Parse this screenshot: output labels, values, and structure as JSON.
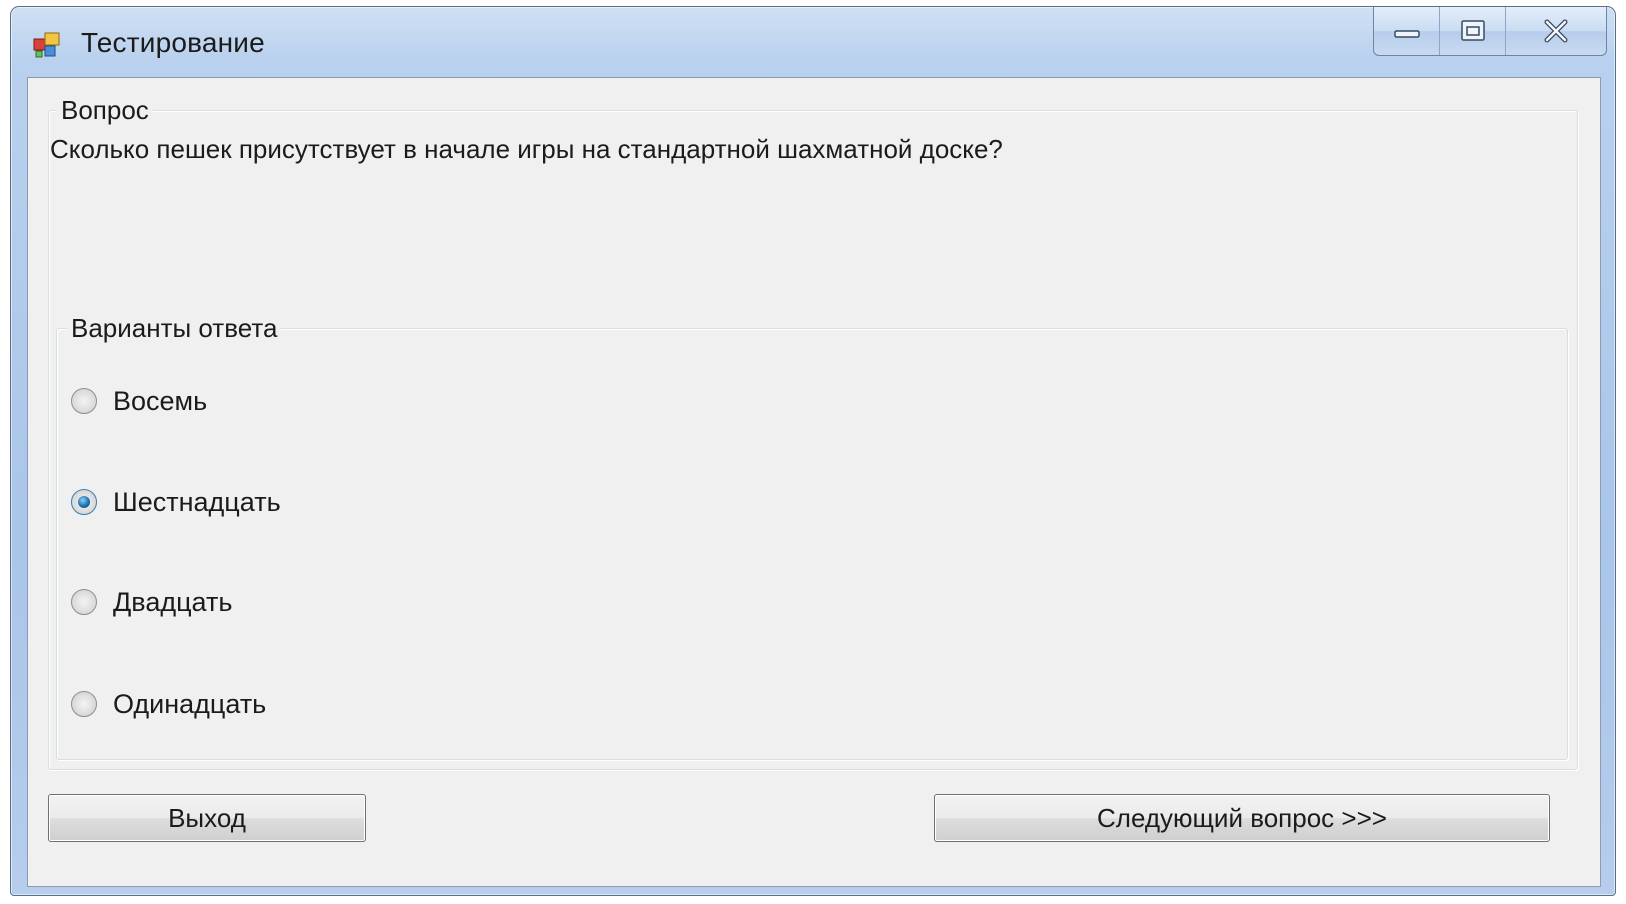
{
  "window": {
    "title": "Тестирование",
    "icon": "app-icon",
    "caption_buttons": [
      "minimize-icon",
      "maximize-icon",
      "close-icon"
    ]
  },
  "question": {
    "group_label": "Вопрос",
    "text": "Сколько пешек присутствует в начале игры на стандартной шахматной доске?"
  },
  "answers": {
    "group_label": "Варианты ответа",
    "options": [
      {
        "label": "Восемь",
        "checked": false
      },
      {
        "label": "Шестнадцать",
        "checked": true
      },
      {
        "label": "Двадцать",
        "checked": false
      },
      {
        "label": "Одинадцать",
        "checked": false
      }
    ]
  },
  "buttons": {
    "exit_label": "Выход",
    "next_label": "Следующий вопрос >>>"
  },
  "colors": {
    "client_bg": "#f0f0f0",
    "title_bar": "#b9d1ee",
    "radio_selected": "#1d6fae"
  }
}
